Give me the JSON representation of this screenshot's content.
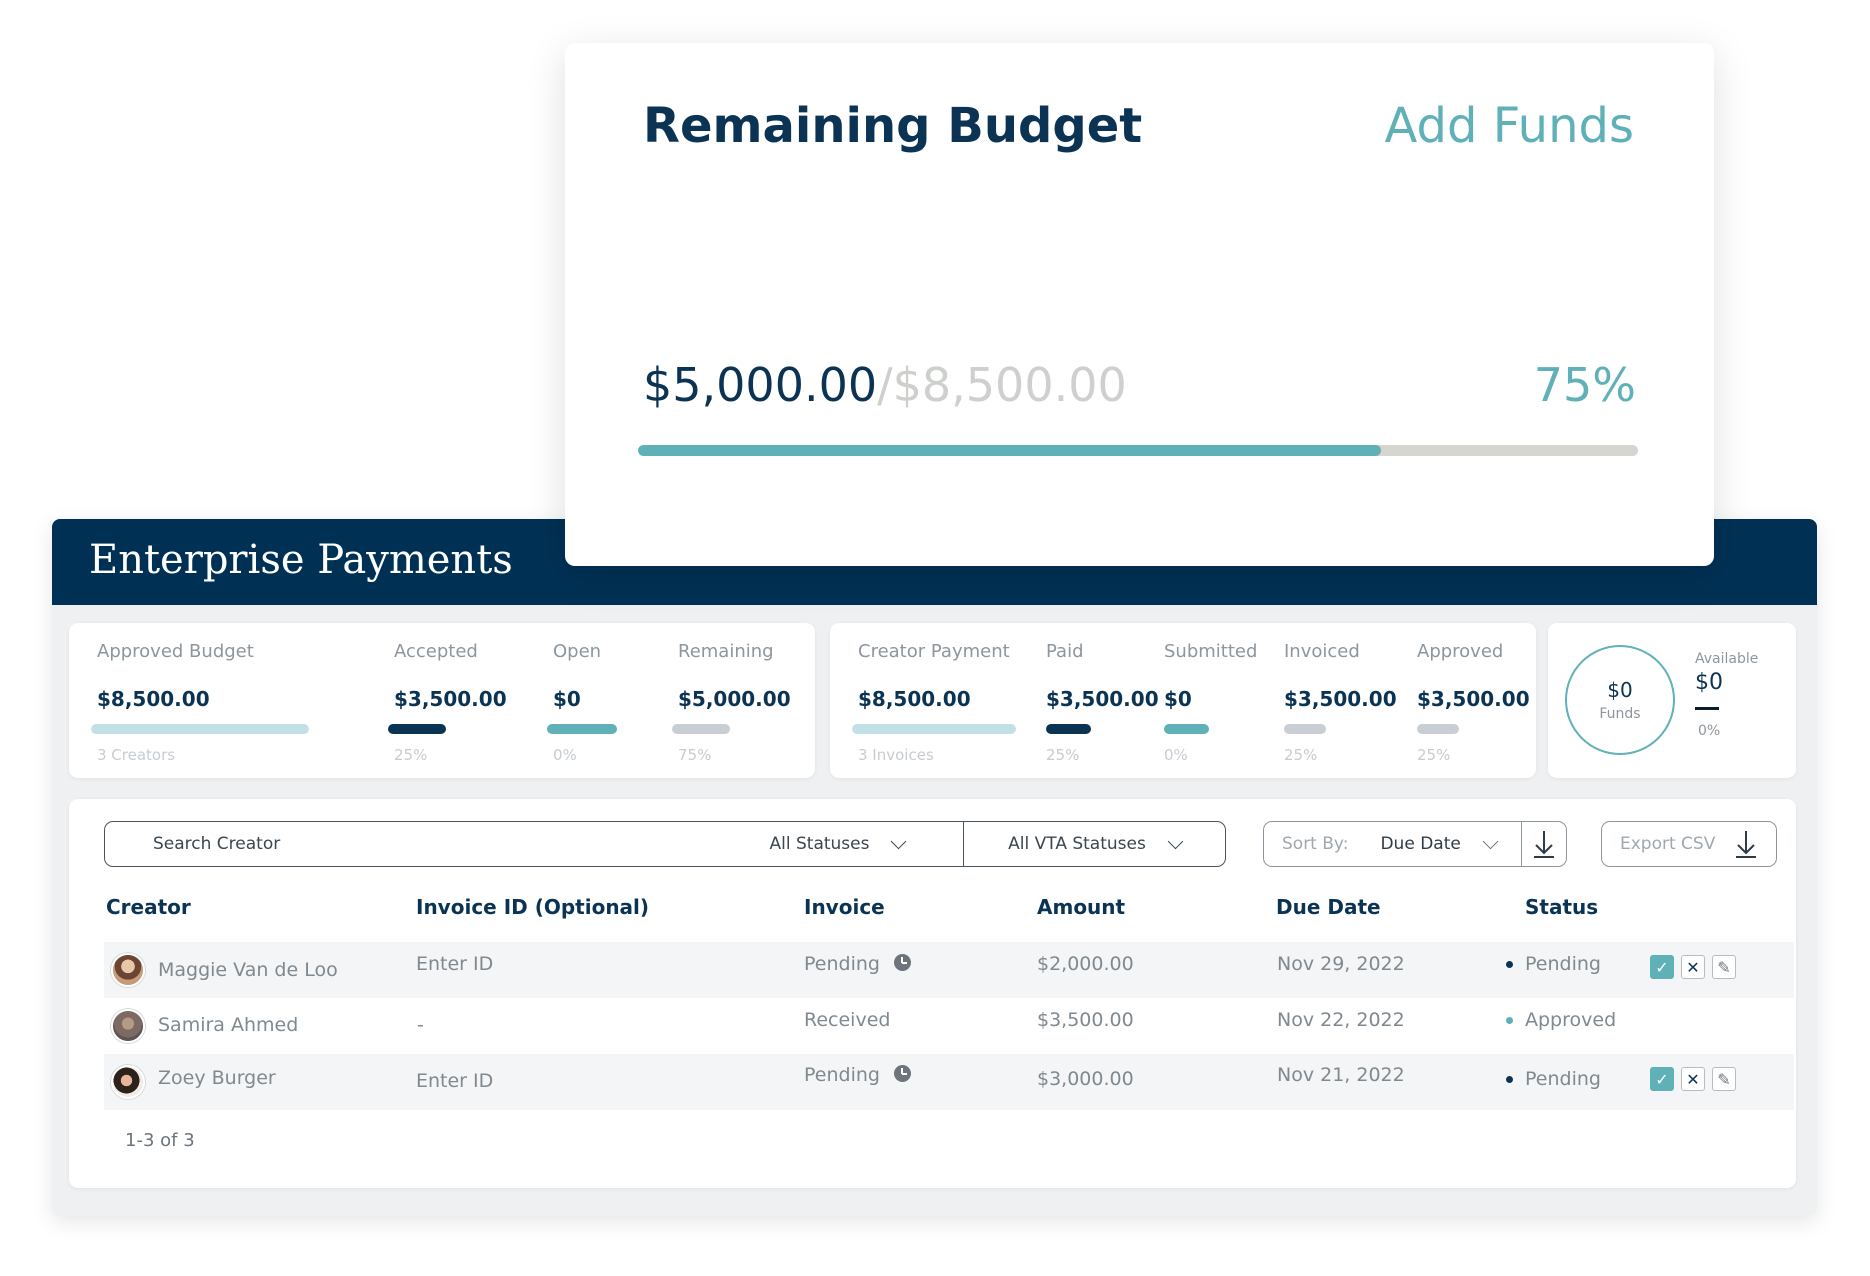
{
  "header": {
    "title": "Enterprise Payments"
  },
  "budget_card": {
    "title": "Remaining Budget",
    "add_funds": "Add Funds",
    "remaining": "$5,000.00",
    "separator": "/",
    "total": "$8,500.00",
    "percent": "75%",
    "progress": 0.743,
    "colors": {
      "fill": "#5fb1b7",
      "track": "#d5d6cf"
    }
  },
  "budget_stats": [
    {
      "label": "Approved Budget",
      "value": "$8,500.00",
      "sub": "3 Creators",
      "color": "#c2e1e6"
    },
    {
      "label": "Accepted",
      "value": "$3,500.00",
      "sub": "25%",
      "color": "#0b3353"
    },
    {
      "label": "Open",
      "value": "$0",
      "sub": "0%",
      "color": "#5fb1b7"
    },
    {
      "label": "Remaining",
      "value": "$5,000.00",
      "sub": "75%",
      "color": "#c8ced4"
    }
  ],
  "payment_stats": [
    {
      "label": "Creator Payment",
      "value": "$8,500.00",
      "sub": "3 Invoices",
      "color": "#c2e1e6"
    },
    {
      "label": "Paid",
      "value": "$3,500.00",
      "sub": "25%",
      "color": "#0b3353"
    },
    {
      "label": "Submitted",
      "value": "$0",
      "sub": "0%",
      "color": "#5fb1b7"
    },
    {
      "label": "Invoiced",
      "value": "$3,500.00",
      "sub": "25%",
      "color": "#c8ced4"
    },
    {
      "label": "Approved",
      "value": "$3,500.00",
      "sub": "25%",
      "color": "#c8ced4"
    }
  ],
  "funds": {
    "circle_value": "$0",
    "circle_label": "Funds",
    "available_label": "Available",
    "available_value": "$0",
    "available_pct": "0%"
  },
  "filters": {
    "search_placeholder": "Search Creator",
    "status": "All Statuses",
    "vta_status": "All VTA Statuses",
    "sort_label": "Sort By:",
    "sort_value": "Due Date",
    "export": "Export CSV"
  },
  "table": {
    "columns": [
      "Creator",
      "Invoice ID (Optional)",
      "Invoice",
      "Amount",
      "Due Date",
      "Status"
    ],
    "rows": [
      {
        "creator": "Maggie Van de Loo",
        "invoice_id": "Enter ID",
        "invoice": "Pending",
        "amount": "$2,000.00",
        "due": "Nov 29, 2022",
        "status": "Pending",
        "status_color": "#0b3353"
      },
      {
        "creator": "Samira Ahmed",
        "invoice_id": "-",
        "invoice": "Received",
        "amount": "$3,500.00",
        "due": "Nov 22, 2022",
        "status": "Approved",
        "status_color": "#5fb1b7"
      },
      {
        "creator": "Zoey Burger",
        "invoice_id": "Enter ID",
        "invoice": "Pending",
        "amount": "$3,000.00",
        "due": "Nov 21, 2022",
        "status": "Pending",
        "status_color": "#0b3353"
      }
    ],
    "pagination": "1-3 of 3"
  },
  "icons": {
    "check": "✓",
    "close": "✕",
    "edit": "✎"
  }
}
